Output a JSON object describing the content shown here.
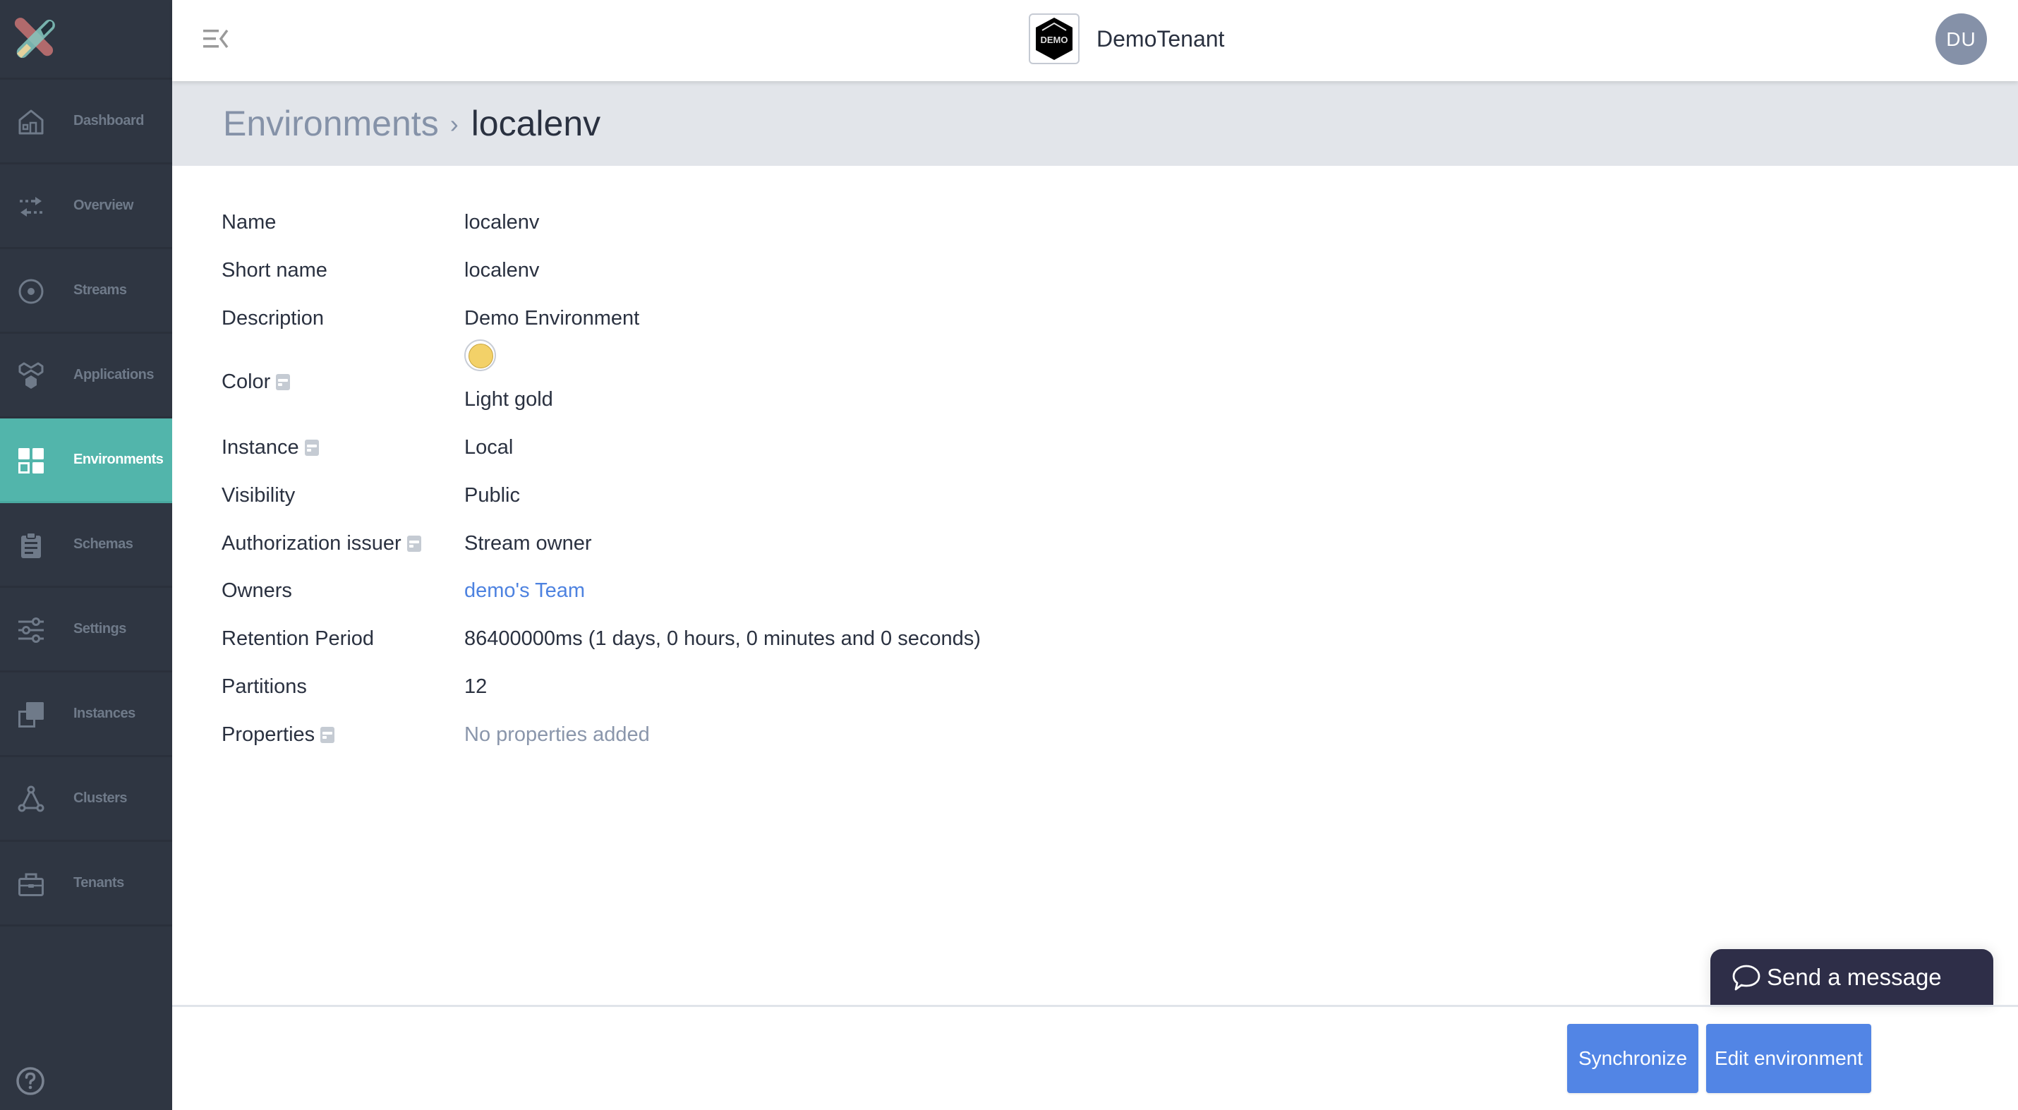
{
  "sidebar": {
    "logo": "app-logo",
    "items": [
      {
        "label": "Dashboard",
        "icon": "home-icon",
        "active": false
      },
      {
        "label": "Overview",
        "icon": "arrows-exchange-icon",
        "active": false
      },
      {
        "label": "Streams",
        "icon": "radio-target-icon",
        "active": false
      },
      {
        "label": "Applications",
        "icon": "applications-icon",
        "active": false
      },
      {
        "label": "Environments",
        "icon": "grid-icon",
        "active": true
      },
      {
        "label": "Schemas",
        "icon": "clipboard-icon",
        "active": false
      },
      {
        "label": "Settings",
        "icon": "sliders-icon",
        "active": false
      },
      {
        "label": "Instances",
        "icon": "instances-icon",
        "active": false
      },
      {
        "label": "Clusters",
        "icon": "cluster-triangle-icon",
        "active": false
      },
      {
        "label": "Tenants",
        "icon": "briefcase-icon",
        "active": false
      }
    ],
    "help_icon": "help-circle-icon"
  },
  "header": {
    "tenant_logo_text": "DEMO",
    "tenant_name": "DemoTenant",
    "avatar_initials": "DU"
  },
  "breadcrumb": {
    "parent": "Environments",
    "separator": "›",
    "current": "localenv"
  },
  "details": {
    "name": {
      "label": "Name",
      "value": "localenv"
    },
    "short_name": {
      "label": "Short name",
      "value": "localenv"
    },
    "description": {
      "label": "Description",
      "value": "Demo Environment"
    },
    "color": {
      "label": "Color",
      "value": "Light gold",
      "swatch": "#f3d168"
    },
    "instance": {
      "label": "Instance",
      "value": "Local"
    },
    "visibility": {
      "label": "Visibility",
      "value": "Public"
    },
    "authorization_issuer": {
      "label": "Authorization issuer",
      "value": "Stream owner"
    },
    "owners": {
      "label": "Owners",
      "value": "demo's Team"
    },
    "retention_period": {
      "label": "Retention Period",
      "value": "86400000ms (1 days, 0 hours, 0 minutes and 0 seconds)"
    },
    "partitions": {
      "label": "Partitions",
      "value": "12"
    },
    "properties": {
      "label": "Properties",
      "value": "No properties added"
    }
  },
  "actions": {
    "synchronize": "Synchronize",
    "edit": "Edit environment"
  },
  "chat": {
    "label": "Send a message"
  },
  "colors": {
    "sidebar_bg": "#2f3642",
    "active_accent": "#52b5ab",
    "primary_button": "#5285e5",
    "link": "#4d82e0",
    "chat_bg": "#2e2e48"
  }
}
